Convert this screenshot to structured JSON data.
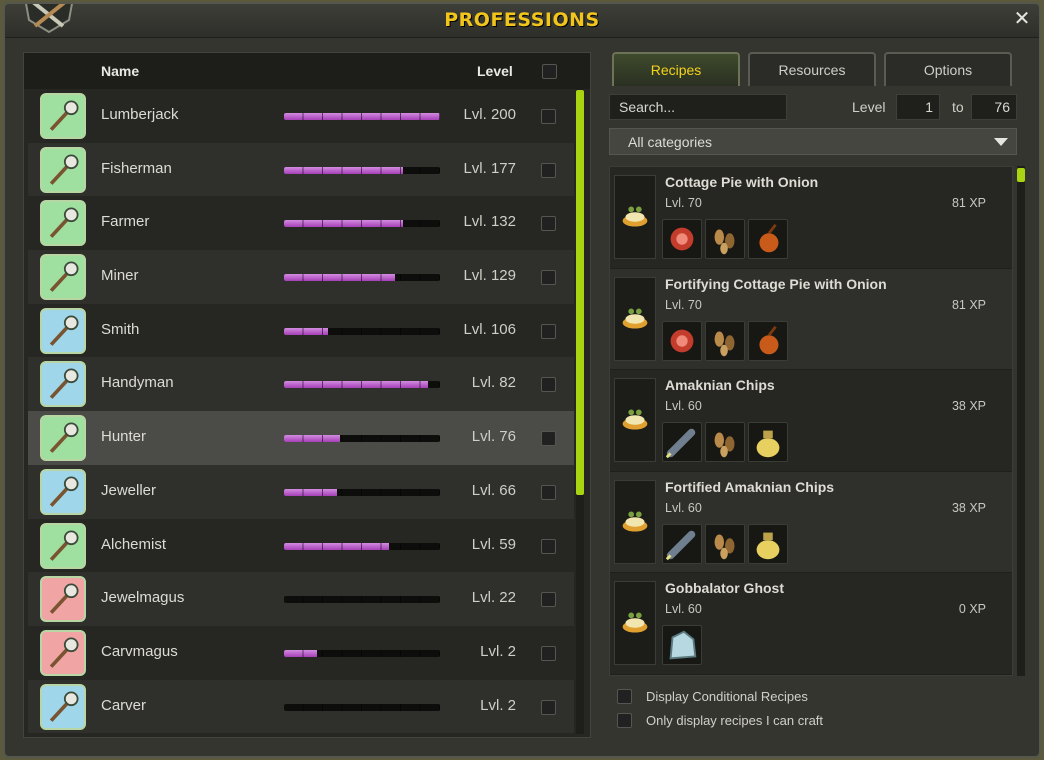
{
  "window": {
    "title": "PROFESSIONS",
    "close_label": "✕"
  },
  "professions": {
    "header": {
      "name": "Name",
      "level": "Level"
    },
    "items": [
      {
        "name": "Lumberjack",
        "level": "Lvl. 200",
        "progress": 1.0,
        "icon": "axe-icon",
        "color": "#9fe0a0"
      },
      {
        "name": "Fisherman",
        "level": "Lvl. 177",
        "progress": 0.76,
        "icon": "fishing-rod-icon",
        "color": "#9fe0a0"
      },
      {
        "name": "Farmer",
        "level": "Lvl. 132",
        "progress": 0.76,
        "icon": "scythe-icon",
        "color": "#9fe0a0"
      },
      {
        "name": "Miner",
        "level": "Lvl. 129",
        "progress": 0.71,
        "icon": "pickaxe-icon",
        "color": "#9fe0a0"
      },
      {
        "name": "Smith",
        "level": "Lvl. 106",
        "progress": 0.28,
        "icon": "anvil-icon",
        "color": "#9fd6ea"
      },
      {
        "name": "Handyman",
        "level": "Lvl. 82",
        "progress": 0.92,
        "icon": "hammer-icon",
        "color": "#9fd6ea"
      },
      {
        "name": "Hunter",
        "level": "Lvl. 76",
        "progress": 0.36,
        "icon": "trap-icon",
        "color": "#9fe0a0"
      },
      {
        "name": "Jeweller",
        "level": "Lvl. 66",
        "progress": 0.34,
        "icon": "gem-icon",
        "color": "#9fd6ea"
      },
      {
        "name": "Alchemist",
        "level": "Lvl. 59",
        "progress": 0.67,
        "icon": "potion-icon",
        "color": "#9fe0a0"
      },
      {
        "name": "Jewelmagus",
        "level": "Lvl. 22",
        "progress": 0.0,
        "icon": "gem-rune-icon",
        "color": "#f0a4a4"
      },
      {
        "name": "Carvmagus",
        "level": "Lvl. 2",
        "progress": 0.21,
        "icon": "bow-rune-icon",
        "color": "#f0a4a4"
      },
      {
        "name": "Carver",
        "level": "Lvl. 2",
        "progress": 0.0,
        "icon": "bow-icon",
        "color": "#9fd6ea"
      }
    ],
    "selected_index": 6
  },
  "tabs": [
    "Recipes",
    "Resources",
    "Options"
  ],
  "filters": {
    "search_placeholder": "Search...",
    "level_label": "Level",
    "level_from": "1",
    "to_label": "to",
    "level_to": "76",
    "category": "All categories"
  },
  "recipes": [
    {
      "name": "Cottage Pie with Onion",
      "level": "Lvl. 70",
      "xp": "81 XP",
      "ingredients": [
        "meat-icon",
        "seeds-icon",
        "onion-icon"
      ]
    },
    {
      "name": "Fortifying Cottage Pie with Onion",
      "level": "Lvl. 70",
      "xp": "81 XP",
      "ingredients": [
        "meat-icon",
        "seeds-icon",
        "onion-icon"
      ]
    },
    {
      "name": "Amaknian Chips",
      "level": "Lvl. 60",
      "xp": "38 XP",
      "ingredients": [
        "root-icon",
        "seeds-icon",
        "oil-jar-icon"
      ]
    },
    {
      "name": "Fortified Amaknian Chips",
      "level": "Lvl. 60",
      "xp": "38 XP",
      "ingredients": [
        "root-icon",
        "seeds-icon",
        "oil-jar-icon"
      ]
    },
    {
      "name": "Gobbalator Ghost",
      "level": "Lvl. 60",
      "xp": "0 XP",
      "ingredients": [
        "ghost-icon"
      ]
    }
  ],
  "options": {
    "conditional": "Display Conditional Recipes",
    "craftable": "Only display recipes I can craft"
  }
}
